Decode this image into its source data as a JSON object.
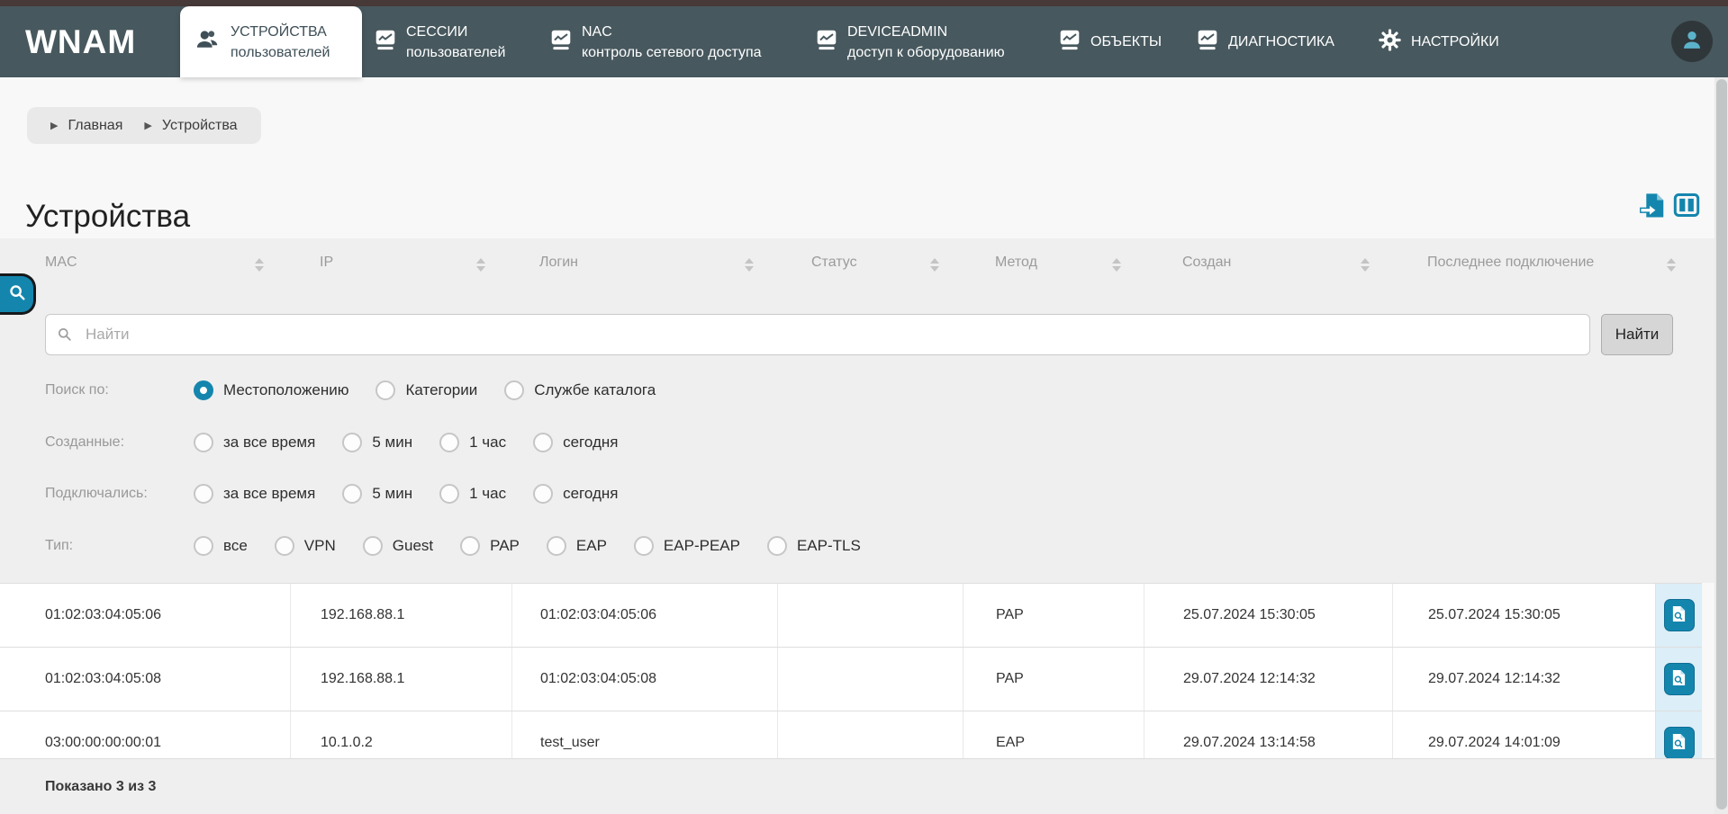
{
  "colors": {
    "accent": "#1486ae",
    "nav_background": "#47585e",
    "top_strip": "#463937",
    "action_cell_background": "#dceef7"
  },
  "nav": {
    "logo": "WNAM",
    "tabs": [
      {
        "title": "УСТРОЙСТВА",
        "subtitle": "пользователей",
        "icon": "users-icon",
        "active": true
      },
      {
        "title": "СЕССИИ",
        "subtitle": "пользователей",
        "icon": "monitor-icon",
        "active": false
      },
      {
        "title": "NAC",
        "subtitle": "контроль сетевого доступа",
        "icon": "monitor-icon",
        "active": false
      },
      {
        "title": "DEVICEADMIN",
        "subtitle": "доступ к оборудованию",
        "icon": "monitor-icon",
        "active": false
      },
      {
        "title": "ОБЪЕКТЫ",
        "subtitle": "",
        "icon": "monitor-icon",
        "active": false
      },
      {
        "title": "ДИАГНОСТИКА",
        "subtitle": "",
        "icon": "monitor-icon",
        "active": false
      },
      {
        "title": "НАСТРОЙКИ",
        "subtitle": "",
        "icon": "gear-icon",
        "active": false
      }
    ]
  },
  "breadcrumb": {
    "items": [
      "Главная",
      "Устройства"
    ]
  },
  "page": {
    "title": "Устройства"
  },
  "search": {
    "placeholder": "Найти",
    "button_label": "Найти"
  },
  "filters": [
    {
      "label": "Поиск по:",
      "options": [
        {
          "text": "Местоположению",
          "selected": true
        },
        {
          "text": "Категории",
          "selected": false
        },
        {
          "text": "Службе каталога",
          "selected": false
        }
      ]
    },
    {
      "label": "Созданные:",
      "options": [
        {
          "text": "за все время",
          "selected": false
        },
        {
          "text": "5 мин",
          "selected": false
        },
        {
          "text": "1 час",
          "selected": false
        },
        {
          "text": "сегодня",
          "selected": false
        }
      ]
    },
    {
      "label": "Подключались:",
      "options": [
        {
          "text": "за все время",
          "selected": false
        },
        {
          "text": "5 мин",
          "selected": false
        },
        {
          "text": "1 час",
          "selected": false
        },
        {
          "text": "сегодня",
          "selected": false
        }
      ]
    },
    {
      "label": "Тип:",
      "options": [
        {
          "text": "все",
          "selected": false
        },
        {
          "text": "VPN",
          "selected": false
        },
        {
          "text": "Guest",
          "selected": false
        },
        {
          "text": "PAP",
          "selected": false
        },
        {
          "text": "EAP",
          "selected": false
        },
        {
          "text": "EAP-PEAP",
          "selected": false
        },
        {
          "text": "EAP-TLS",
          "selected": false
        }
      ]
    }
  ],
  "table": {
    "columns": [
      "MAC",
      "IP",
      "Логин",
      "Статус",
      "Метод",
      "Создан",
      "Последнее подключение"
    ],
    "rows": [
      {
        "mac": "01:02:03:04:05:06",
        "ip": "192.168.88.1",
        "login": "01:02:03:04:05:06",
        "status": "",
        "method": "PAP",
        "created": "25.07.2024 15:30:05",
        "last_connection": "25.07.2024 15:30:05"
      },
      {
        "mac": "01:02:03:04:05:08",
        "ip": "192.168.88.1",
        "login": "01:02:03:04:05:08",
        "status": "",
        "method": "PAP",
        "created": "29.07.2024 12:14:32",
        "last_connection": "29.07.2024 12:14:32"
      },
      {
        "mac": "03:00:00:00:00:01",
        "ip": "10.1.0.2",
        "login": "test_user",
        "status": "",
        "method": "EAP",
        "created": "29.07.2024 13:14:58",
        "last_connection": "29.07.2024 14:01:09"
      }
    ],
    "footer": "Показано 3 из 3"
  }
}
